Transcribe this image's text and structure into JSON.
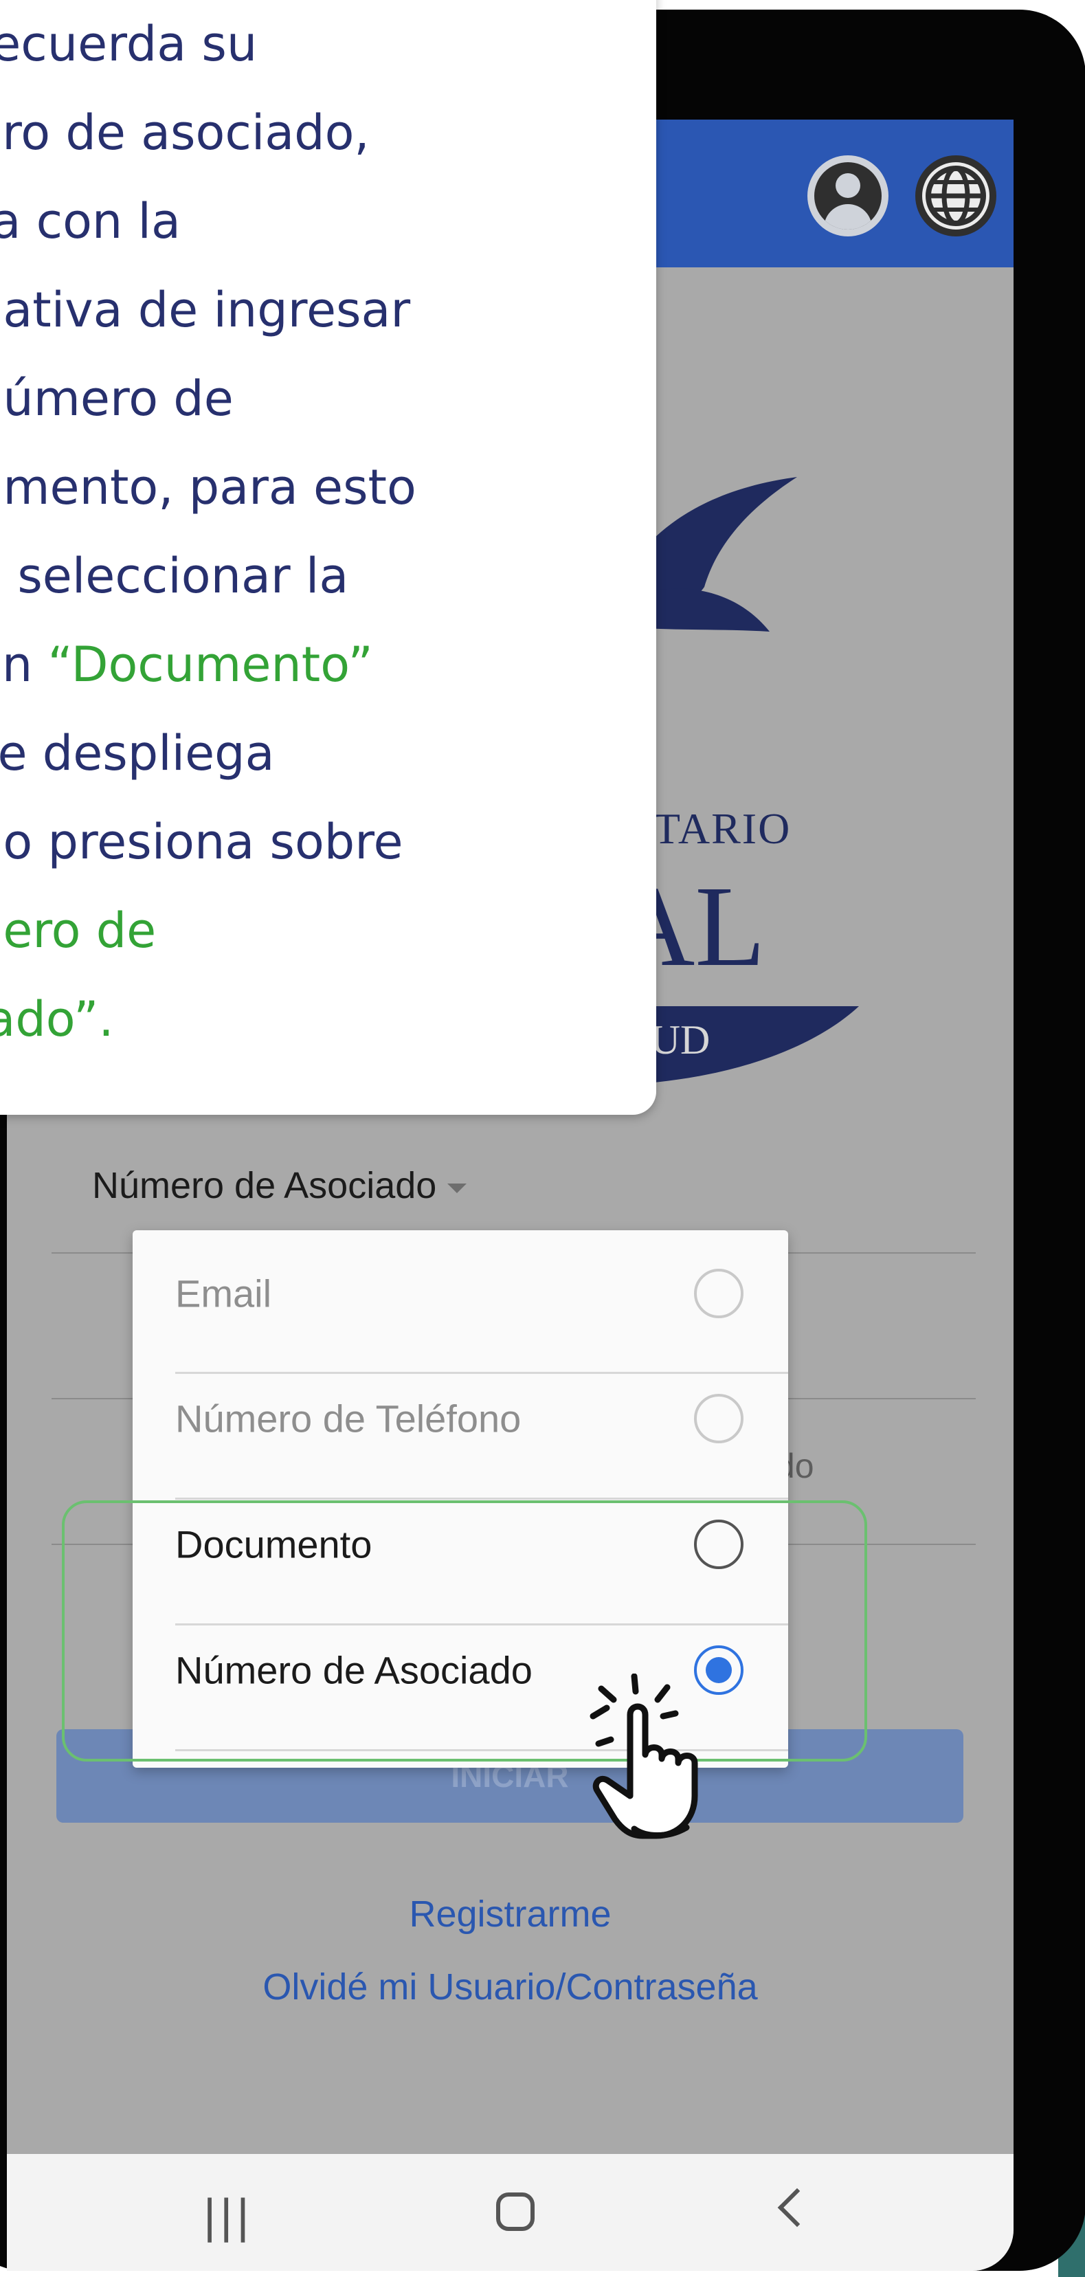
{
  "callout": {
    "lines_before": [
      "recuerda su",
      "ero de asociado,",
      "ta con la",
      "nativa de ingresar",
      "número de",
      "umento, para esto",
      "e seleccionar la"
    ],
    "line8_prefix": "ón ",
    "line8_highlight": "“Documento”",
    "lines_middle": [
      "se despliega",
      "do presiona sobre"
    ],
    "highlight_lines": [
      "nero de",
      "iado”."
    ]
  },
  "logo": {
    "line1": "SITARIO",
    "line2": "AL",
    "band": "LUD"
  },
  "login_form": {
    "identifier_type": "Número de Asociado",
    "field_placeholder_fragment": "iado",
    "login_button": "INICIAR"
  },
  "dropdown": {
    "options": [
      {
        "label": "Email",
        "enabled": false,
        "selected": false
      },
      {
        "label": "Número de Teléfono",
        "enabled": false,
        "selected": false
      },
      {
        "label": "Documento",
        "enabled": true,
        "selected": false
      },
      {
        "label": "Número de Asociado",
        "enabled": true,
        "selected": true
      }
    ]
  },
  "links": {
    "register": "Registrarme",
    "forgot": "Olvidé mi Usuario/Contraseña"
  },
  "appbar": {
    "icons": [
      "account-circle-icon",
      "globe-icon"
    ]
  },
  "navbar": {
    "icons": [
      "recents-icon",
      "home-icon",
      "back-icon"
    ]
  },
  "colors": {
    "appbar": "#2b57b3",
    "callout_text": "#27306e",
    "callout_highlight": "#33a336",
    "radio_selected": "#2f73e0",
    "highlight_box": "#6bc070"
  }
}
